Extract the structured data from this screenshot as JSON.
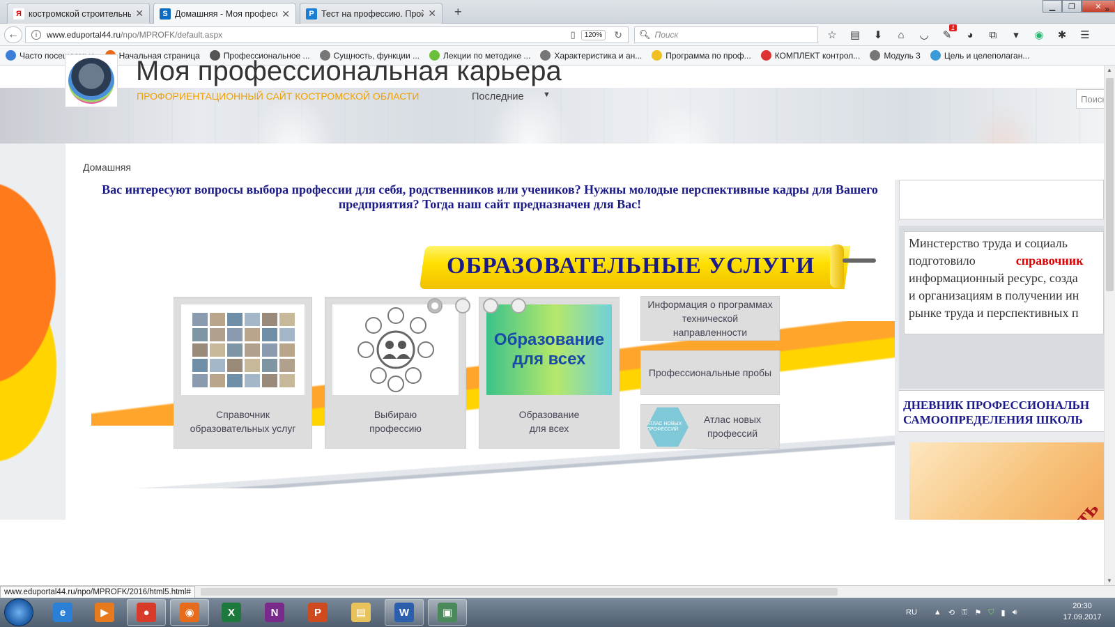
{
  "browser": {
    "tabs": [
      {
        "title": "костромской строительный ...",
        "favicon": "Я",
        "favicon_color": "#ffffff",
        "favicon_text_color": "#e00000"
      },
      {
        "title": "Домашняя - Моя професси...",
        "favicon": "S",
        "favicon_color": "#0a6bbf",
        "favicon_text_color": "#ffffff"
      },
      {
        "title": "Тест на профессию. Пройти...",
        "favicon": "P",
        "favicon_color": "#1a7fd4",
        "favicon_text_color": "#ffffff"
      }
    ],
    "url_host": "www.eduportal44.ru",
    "url_path": "/npo/MPROFK/default.aspx",
    "zoom": "120%",
    "search_placeholder": "Поиск",
    "bookmarks": [
      {
        "label": "Часто посещаемые",
        "color": "#3b7fd8"
      },
      {
        "label": "Начальная страница",
        "color": "#e66b1a"
      },
      {
        "label": "Профессиональное ...",
        "color": "#555"
      },
      {
        "label": "Сущность, функции ...",
        "color": "#777"
      },
      {
        "label": "Лекции по методике ...",
        "color": "#6bbf3a"
      },
      {
        "label": "Характеристика и ан...",
        "color": "#777"
      },
      {
        "label": "Программа по проф...",
        "color": "#f0c020"
      },
      {
        "label": "КОМПЛЕКТ контрол...",
        "color": "#d33"
      },
      {
        "label": "Модуль 3",
        "color": "#777"
      },
      {
        "label": "Цель и целеполаган...",
        "color": "#3b9ad8"
      }
    ],
    "bookmarks_more": "»",
    "notification_count": "1"
  },
  "site": {
    "title": "Моя профессиональная карьера",
    "subtitle": "ПРОФОРИЕНТАЦИОННЫЙ САЙТ КОСТРОМСКОЙ ОБЛАСТИ",
    "recent": "Последние",
    "search_placeholder": "Поиск",
    "breadcrumb": "Домашняя",
    "headline": "Вас интересуют вопросы выбора профессии для себя, родственников или учеников? Нужны молодые перспективные кадры для Вашего предприятия? Тогда наш сайт предназначен для Вас!"
  },
  "slider": {
    "ribbon_title": "ОБРАЗОВАТЕЛЬНЫЕ УСЛУГИ",
    "tiles": [
      {
        "label_line1": "Справочник",
        "label_line2": "образовательных услуг"
      },
      {
        "label_line1": "Выбираю",
        "label_line2": "профессию"
      },
      {
        "label_line1": "Образование",
        "label_line2": "для всех",
        "image_text1": "Образование",
        "image_text2": "для всех"
      }
    ],
    "mini": [
      {
        "label": "Информация о программах технической направленности"
      },
      {
        "label": "Профессиональные пробы"
      },
      {
        "label": "Атлас новых профессий",
        "badge": "АТЛАС НОВЫХ ПРОФЕССИЙ"
      }
    ],
    "dots_total": 4,
    "active_dot": 1
  },
  "right": {
    "text_lines": [
      "Минстерство труда и социаль",
      "подготовило",
      "справочник",
      "информационный ресурс, созда",
      "и организациям в получении ин",
      "рынке труда и перспективных п"
    ],
    "diary_line1": "ДНЕВНИК    ПРОФЕССИОНАЛЬН",
    "diary_line2": "САМООПРЕДЕЛЕНИЯ     ШКОЛЬ",
    "diary_image_text": "брать"
  },
  "status_url": "www.eduportal44.ru/npo/MPROFK/2016/html5.html#",
  "taskbar": {
    "lang": "RU",
    "time": "20:30",
    "date": "17.09.2017",
    "apps": [
      {
        "name": "ie",
        "glyph": "e",
        "color": "#2a7fd6"
      },
      {
        "name": "media",
        "glyph": "▶",
        "color": "#e87a1e"
      },
      {
        "name": "chrome",
        "glyph": "●",
        "color": "#d93b2b"
      },
      {
        "name": "firefox",
        "glyph": "◉",
        "color": "#e66b1a"
      },
      {
        "name": "excel",
        "glyph": "X",
        "color": "#1e7a3c"
      },
      {
        "name": "onenote",
        "glyph": "N",
        "color": "#7a2a8a"
      },
      {
        "name": "powerpoint",
        "glyph": "P",
        "color": "#d04a20"
      },
      {
        "name": "explorer",
        "glyph": "▤",
        "color": "#e8c25a"
      },
      {
        "name": "word",
        "glyph": "W",
        "color": "#2b5fad"
      },
      {
        "name": "remote",
        "glyph": "▣",
        "color": "#4a8a5a"
      }
    ]
  }
}
